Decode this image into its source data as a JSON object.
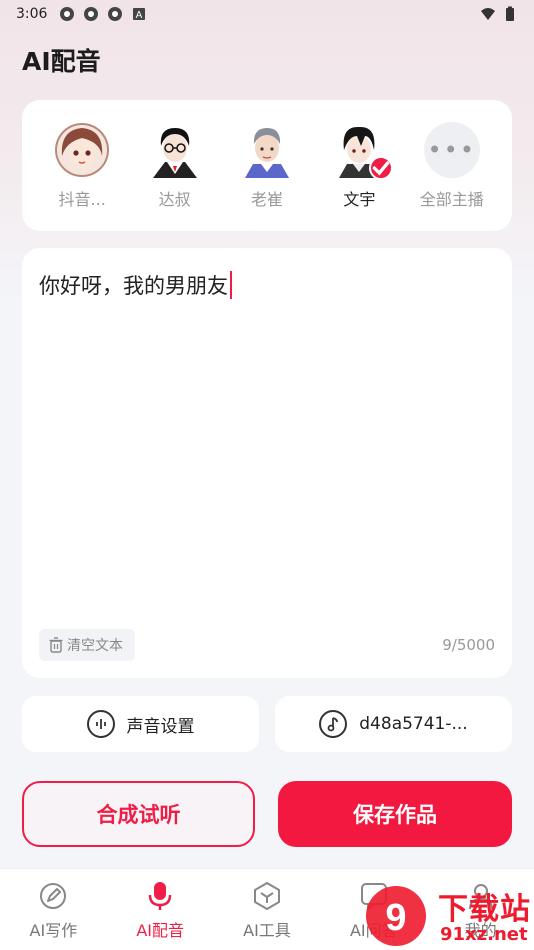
{
  "status": {
    "time": "3:06",
    "left_icons": [
      "gear-like-icon",
      "gear-like-icon",
      "gear-like-icon",
      "a-box-icon"
    ],
    "right_icons": [
      "wifi-icon",
      "battery-icon"
    ]
  },
  "header": {
    "title": "AI配音"
  },
  "voices": [
    {
      "name": "抖音...",
      "avatar": "girl-avatar-icon",
      "selected": false
    },
    {
      "name": "达叔",
      "avatar": "glasses-man-avatar-icon",
      "selected": false
    },
    {
      "name": "老崔",
      "avatar": "old-man-avatar-icon",
      "selected": false
    },
    {
      "name": "文宇",
      "avatar": "young-man-avatar-icon",
      "selected": true
    }
  ],
  "all_voices": {
    "label": "全部主播",
    "icon": "more-dots-icon"
  },
  "editor": {
    "text": "你好呀，我的男朋友",
    "clear_label": "清空文本",
    "count": "9/5000"
  },
  "settings": {
    "voice_label": "声音设置",
    "music_label": "d48a5741-..."
  },
  "actions": {
    "listen_label": "合成试听",
    "save_label": "保存作品"
  },
  "tabs": [
    {
      "label": "AI写作",
      "icon": "pen-icon",
      "active": false
    },
    {
      "label": "AI配音",
      "icon": "microphone-icon",
      "active": true
    },
    {
      "label": "AI工具",
      "icon": "cube-icon",
      "active": false
    },
    {
      "label": "AI问答",
      "icon": "chat-icon",
      "active": false
    },
    {
      "label": "我的",
      "icon": "user-icon",
      "active": false
    }
  ],
  "watermark": {
    "line1": "下载站",
    "line2": "91xz.net"
  },
  "colors": {
    "accent": "#f01d46",
    "save_bg": "#f2183f"
  }
}
